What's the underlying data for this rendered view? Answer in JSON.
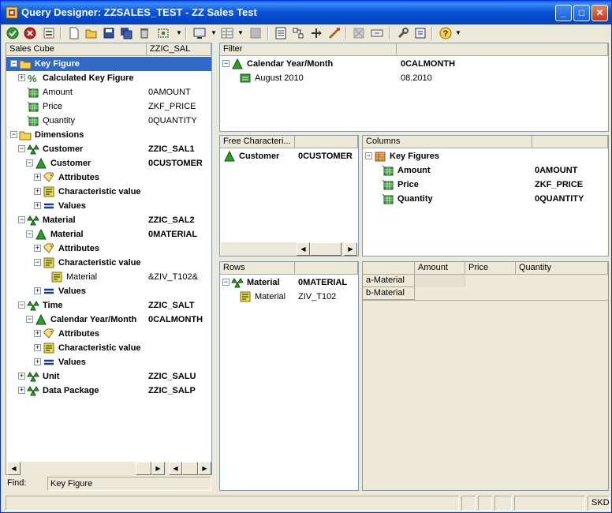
{
  "window": {
    "title": "Query Designer: ZZSALES_TEST - ZZ Sales Test"
  },
  "colors": {
    "title_bar": "#0a56d8",
    "selection": "#316ac5",
    "face": "#ece9d8",
    "key_figure_icon": "#2e8b2e",
    "dimension_icon": "#2aa02a"
  },
  "toolbar": {
    "icons": [
      "check-icon",
      "cancel-icon",
      "execute-icon",
      "new-icon",
      "open-icon",
      "save-icon",
      "save-all-icon",
      "delete-icon",
      "exit-icon",
      "view-icon",
      "tabular-icon",
      "grid-icon",
      "properties-icon",
      "tasks-icon",
      "cells-icon",
      "conditions-icon",
      "exceptions-icon",
      "filter-icon",
      "tools-icon",
      "info-icon",
      "help-icon"
    ]
  },
  "tree": {
    "headers": [
      "Sales Cube",
      "ZZIC_SAL"
    ],
    "nodes": [
      {
        "label": "Key Figure",
        "tech": "",
        "bold": true,
        "level": 0,
        "expander": "minus",
        "icon": "folder",
        "selected": true
      },
      {
        "label": "Calculated Key Figure",
        "tech": "",
        "bold": true,
        "level": 1,
        "expander": "plus",
        "icon": "calc"
      },
      {
        "label": "Amount",
        "tech": "0AMOUNT",
        "bold": false,
        "level": 1,
        "expander": "",
        "icon": "keyfig"
      },
      {
        "label": "Price",
        "tech": "ZKF_PRICE",
        "bold": false,
        "level": 1,
        "expander": "",
        "icon": "keyfig"
      },
      {
        "label": "Quantity",
        "tech": "0QUANTITY",
        "bold": false,
        "level": 1,
        "expander": "",
        "icon": "keyfig"
      },
      {
        "label": "Dimensions",
        "tech": "",
        "bold": true,
        "level": 0,
        "expander": "minus",
        "icon": "folder"
      },
      {
        "label": "Customer",
        "tech": "ZZIC_SAL1",
        "bold": true,
        "level": 1,
        "expander": "minus",
        "icon": "dims"
      },
      {
        "label": "Customer",
        "tech": "0CUSTOMER",
        "bold": true,
        "level": 2,
        "expander": "minus",
        "icon": "char"
      },
      {
        "label": "Attributes",
        "tech": "",
        "bold": true,
        "level": 3,
        "expander": "plus",
        "icon": "attr"
      },
      {
        "label": "Characteristic value",
        "tech": "",
        "bold": true,
        "level": 3,
        "expander": "plus",
        "icon": "charval"
      },
      {
        "label": "Values",
        "tech": "",
        "bold": true,
        "level": 3,
        "expander": "plus",
        "icon": "values"
      },
      {
        "label": "Material",
        "tech": "ZZIC_SAL2",
        "bold": true,
        "level": 1,
        "expander": "minus",
        "icon": "dims"
      },
      {
        "label": "Material",
        "tech": "0MATERIAL",
        "bold": true,
        "level": 2,
        "expander": "minus",
        "icon": "char"
      },
      {
        "label": "Attributes",
        "tech": "",
        "bold": true,
        "level": 3,
        "expander": "plus",
        "icon": "attr"
      },
      {
        "label": "Characteristic value",
        "tech": "",
        "bold": true,
        "level": 3,
        "expander": "minus",
        "icon": "charval"
      },
      {
        "label": "Material",
        "tech": "&ZIV_T102&",
        "bold": false,
        "level": 4,
        "expander": "",
        "icon": "charval"
      },
      {
        "label": "Values",
        "tech": "",
        "bold": true,
        "level": 3,
        "expander": "plus",
        "icon": "values"
      },
      {
        "label": "Time",
        "tech": "ZZIC_SALT",
        "bold": true,
        "level": 1,
        "expander": "minus",
        "icon": "dims"
      },
      {
        "label": "Calendar Year/Month",
        "tech": "0CALMONTH",
        "bold": true,
        "level": 2,
        "expander": "minus",
        "icon": "char"
      },
      {
        "label": "Attributes",
        "tech": "",
        "bold": true,
        "level": 3,
        "expander": "plus",
        "icon": "attr"
      },
      {
        "label": "Characteristic value",
        "tech": "",
        "bold": true,
        "level": 3,
        "expander": "plus",
        "icon": "charval"
      },
      {
        "label": "Values",
        "tech": "",
        "bold": true,
        "level": 3,
        "expander": "plus",
        "icon": "values"
      },
      {
        "label": "Unit",
        "tech": "ZZIC_SALU",
        "bold": true,
        "level": 1,
        "expander": "plus",
        "icon": "dims"
      },
      {
        "label": "Data Package",
        "tech": "ZZIC_SALP",
        "bold": true,
        "level": 1,
        "expander": "plus",
        "icon": "dims"
      }
    ]
  },
  "find": {
    "label": "Find:",
    "value": "Key Figure"
  },
  "filter": {
    "header": "Filter",
    "items": [
      {
        "label": "Calendar Year/Month",
        "tech": "0CALMONTH",
        "bold": true
      },
      {
        "label": "August 2010",
        "tech": "08.2010",
        "bold": false
      }
    ]
  },
  "free": {
    "header": "Free Characteri...",
    "items": [
      {
        "label": "Customer",
        "tech": "0CUSTOMER"
      }
    ]
  },
  "columns": {
    "header": "Columns",
    "root": "Key Figures",
    "items": [
      {
        "label": "Amount",
        "tech": "0AMOUNT"
      },
      {
        "label": "Price",
        "tech": "ZKF_PRICE"
      },
      {
        "label": "Quantity",
        "tech": "0QUANTITY"
      }
    ]
  },
  "rows": {
    "header": "Rows",
    "items": [
      {
        "label": "Material",
        "tech": "0MATERIAL",
        "bold": true
      },
      {
        "label": "Material",
        "tech": "ZIV_T102",
        "bold": false
      }
    ]
  },
  "preview": {
    "col_headers": [
      "Amount",
      "Price",
      "Quantity"
    ],
    "row_headers": [
      "a-Material",
      "b-Material"
    ]
  },
  "status": {
    "system": "SKD"
  }
}
